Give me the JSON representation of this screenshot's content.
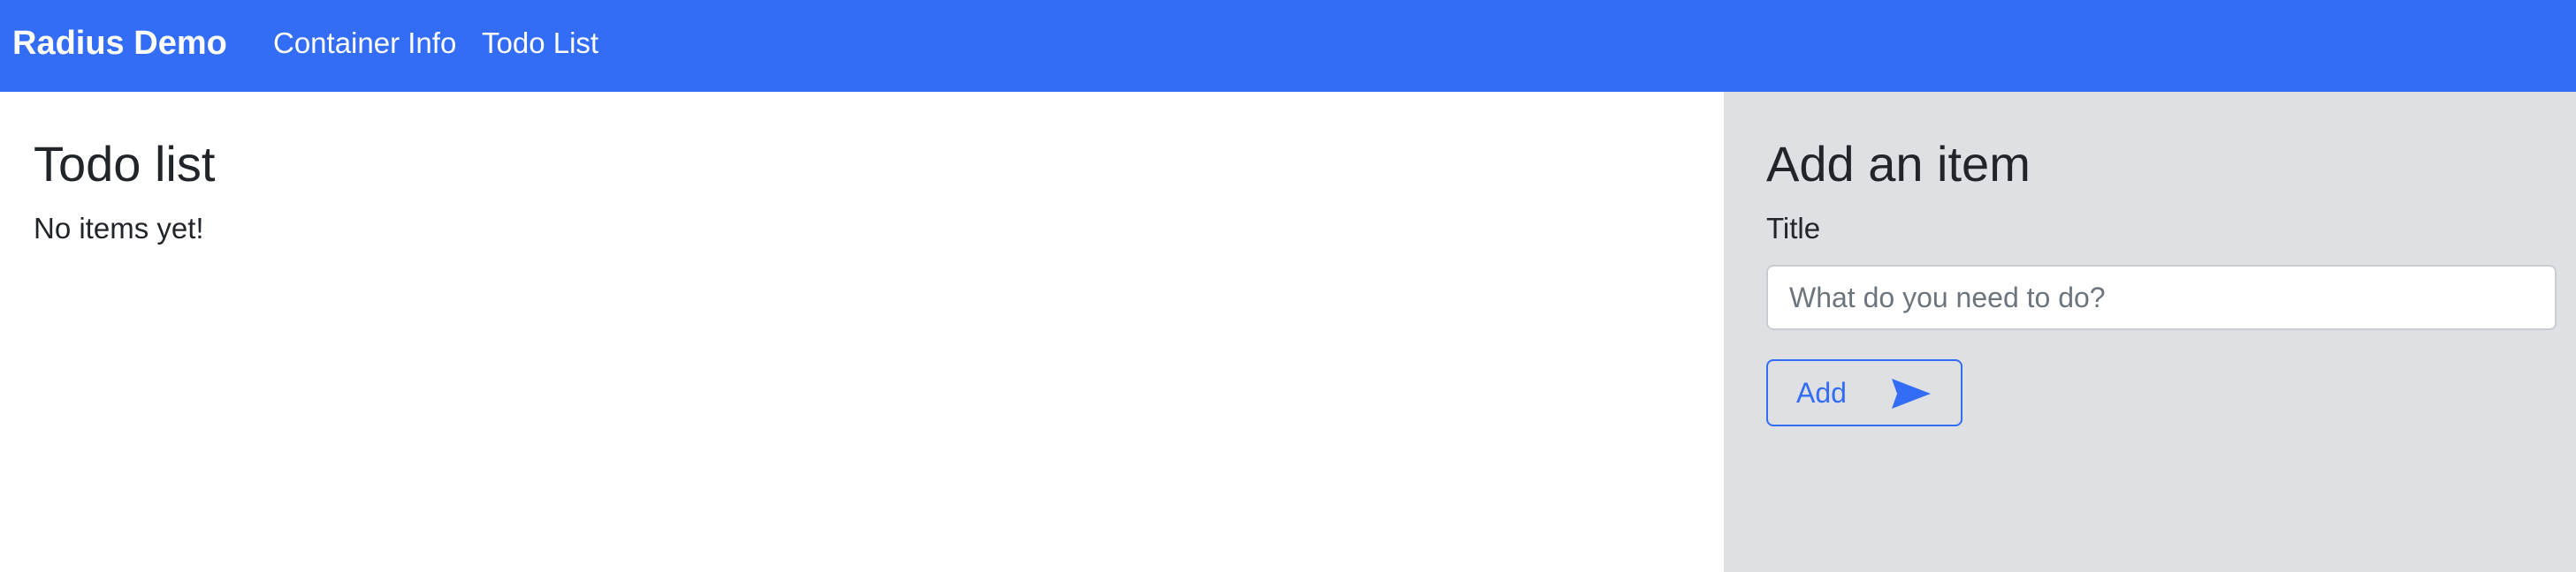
{
  "navbar": {
    "brand": "Radius Demo",
    "links": [
      {
        "label": "Container Info"
      },
      {
        "label": "Todo List"
      }
    ],
    "background": "#336cf5"
  },
  "todo": {
    "heading": "Todo list",
    "empty_message": "No items yet!"
  },
  "add_item": {
    "heading": "Add an item",
    "title_label": "Title",
    "title_input": {
      "value": "",
      "placeholder": "What do you need to do?"
    },
    "add_button_label": "Add",
    "add_button_icon": "send-icon",
    "panel_background": "#dee0e3",
    "accent": "#336cf5"
  }
}
